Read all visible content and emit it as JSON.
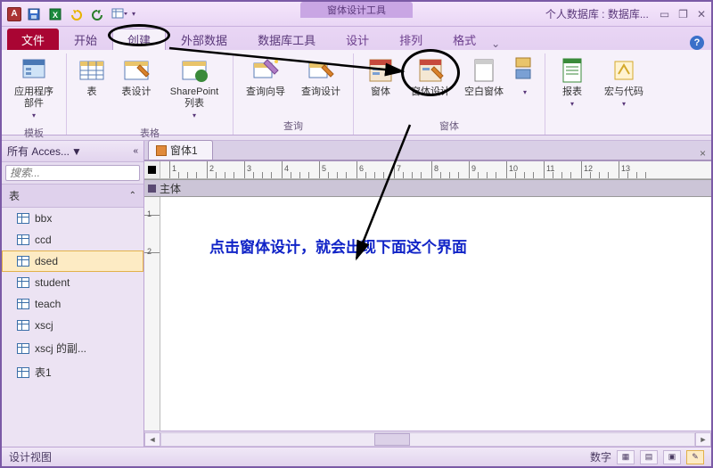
{
  "app": {
    "letter": "A"
  },
  "qat": {
    "save_title": "保存",
    "excel_title": "Excel",
    "undo_title": "撤销",
    "redo_title": "恢复"
  },
  "title": {
    "contextual_label": "窗体设计工具",
    "right_text": "个人数据库 : 数据库..."
  },
  "win": {
    "min": "▭",
    "restore": "❐",
    "close": "✕"
  },
  "tabs": {
    "file": "文件",
    "home": "开始",
    "create": "创建",
    "external": "外部数据",
    "dbtools": "数据库工具",
    "design": "设计",
    "arrange": "排列",
    "format": "格式"
  },
  "ribbon": {
    "group_templates": "模板",
    "group_tables": "表格",
    "group_queries": "查询",
    "group_forms": "窗体",
    "btn_app_parts": "应用程序部件",
    "btn_table": "表",
    "btn_table_design": "表设计",
    "btn_sharepoint": "SharePoint 列表",
    "btn_query_wizard": "查询向导",
    "btn_query_design": "查询设计",
    "btn_form": "窗体",
    "btn_form_design": "窗体设计",
    "btn_blank_form": "空白窗体",
    "btn_report": "报表",
    "btn_macro": "宏与代码"
  },
  "nav": {
    "header": "所有 Acces...",
    "search_placeholder": "搜索...",
    "group_tables": "表",
    "items": [
      {
        "label": "bbx"
      },
      {
        "label": "ccd"
      },
      {
        "label": "dsed"
      },
      {
        "label": "student"
      },
      {
        "label": "teach"
      },
      {
        "label": "xscj"
      },
      {
        "label": "xscj 的副..."
      },
      {
        "label": "表1"
      }
    ],
    "selected_index": 2
  },
  "doc": {
    "tab_label": "窗体1",
    "section_body": "主体",
    "annotation": "点击窗体设计，就会出现下面这个界面",
    "ruler_marks": [
      "1",
      "2",
      "3",
      "4",
      "5",
      "6",
      "7",
      "8",
      "9",
      "10",
      "11",
      "12",
      "13"
    ],
    "vruler_marks": [
      "1",
      "2"
    ]
  },
  "status": {
    "left": "设计视图",
    "right_text": "数字"
  }
}
